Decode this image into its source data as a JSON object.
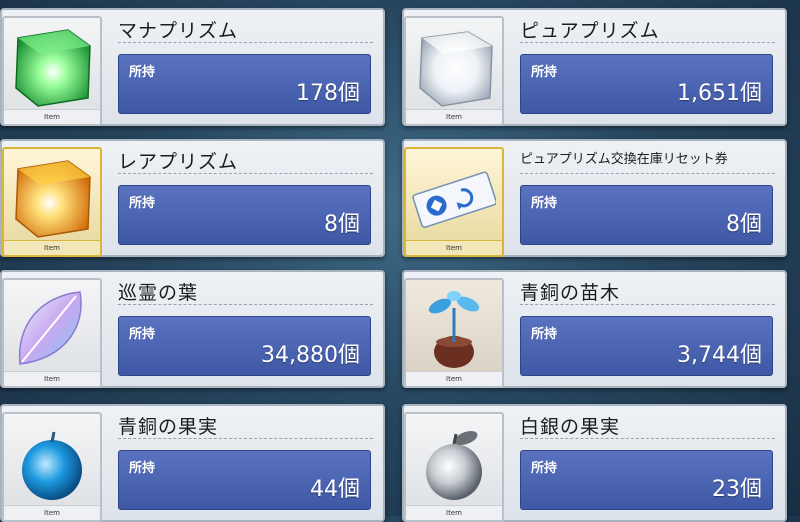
{
  "items": [
    {
      "name": "マナプリズム",
      "owned_label": "所持",
      "count": "178個",
      "thumb_label": "Item",
      "icon": "green-prism-cube-icon",
      "color": "#2fd05a"
    },
    {
      "name": "ピュアプリズム",
      "owned_label": "所持",
      "count": "1,651個",
      "thumb_label": "Item",
      "icon": "white-prism-cube-icon",
      "color": "#e8eef5"
    },
    {
      "name": "レアプリズム",
      "owned_label": "所持",
      "count": "8個",
      "thumb_label": "Item",
      "icon": "gold-prism-cube-icon",
      "color": "#f0a820"
    },
    {
      "name": "ピュアプリズム交換在庫リセット券",
      "owned_label": "所持",
      "count": "8個",
      "thumb_label": "Item",
      "icon": "reset-ticket-icon",
      "color": "#2a6bd0"
    },
    {
      "name": "巡霊の葉",
      "owned_label": "所持",
      "count": "34,880個",
      "thumb_label": "Item",
      "icon": "spirit-leaf-icon",
      "color": "#c9a8f0"
    },
    {
      "name": "青銅の苗木",
      "owned_label": "所持",
      "count": "3,744個",
      "thumb_label": "Item",
      "icon": "bronze-sapling-icon",
      "color": "#3aa0e0"
    },
    {
      "name": "青銅の果実",
      "owned_label": "所持",
      "count": "44個",
      "thumb_label": "Item",
      "icon": "bronze-fruit-icon",
      "color": "#1e9ae0"
    },
    {
      "name": "白銀の果実",
      "owned_label": "所持",
      "count": "23個",
      "thumb_label": "Item",
      "icon": "silver-fruit-icon",
      "color": "#c8ccd2"
    }
  ]
}
